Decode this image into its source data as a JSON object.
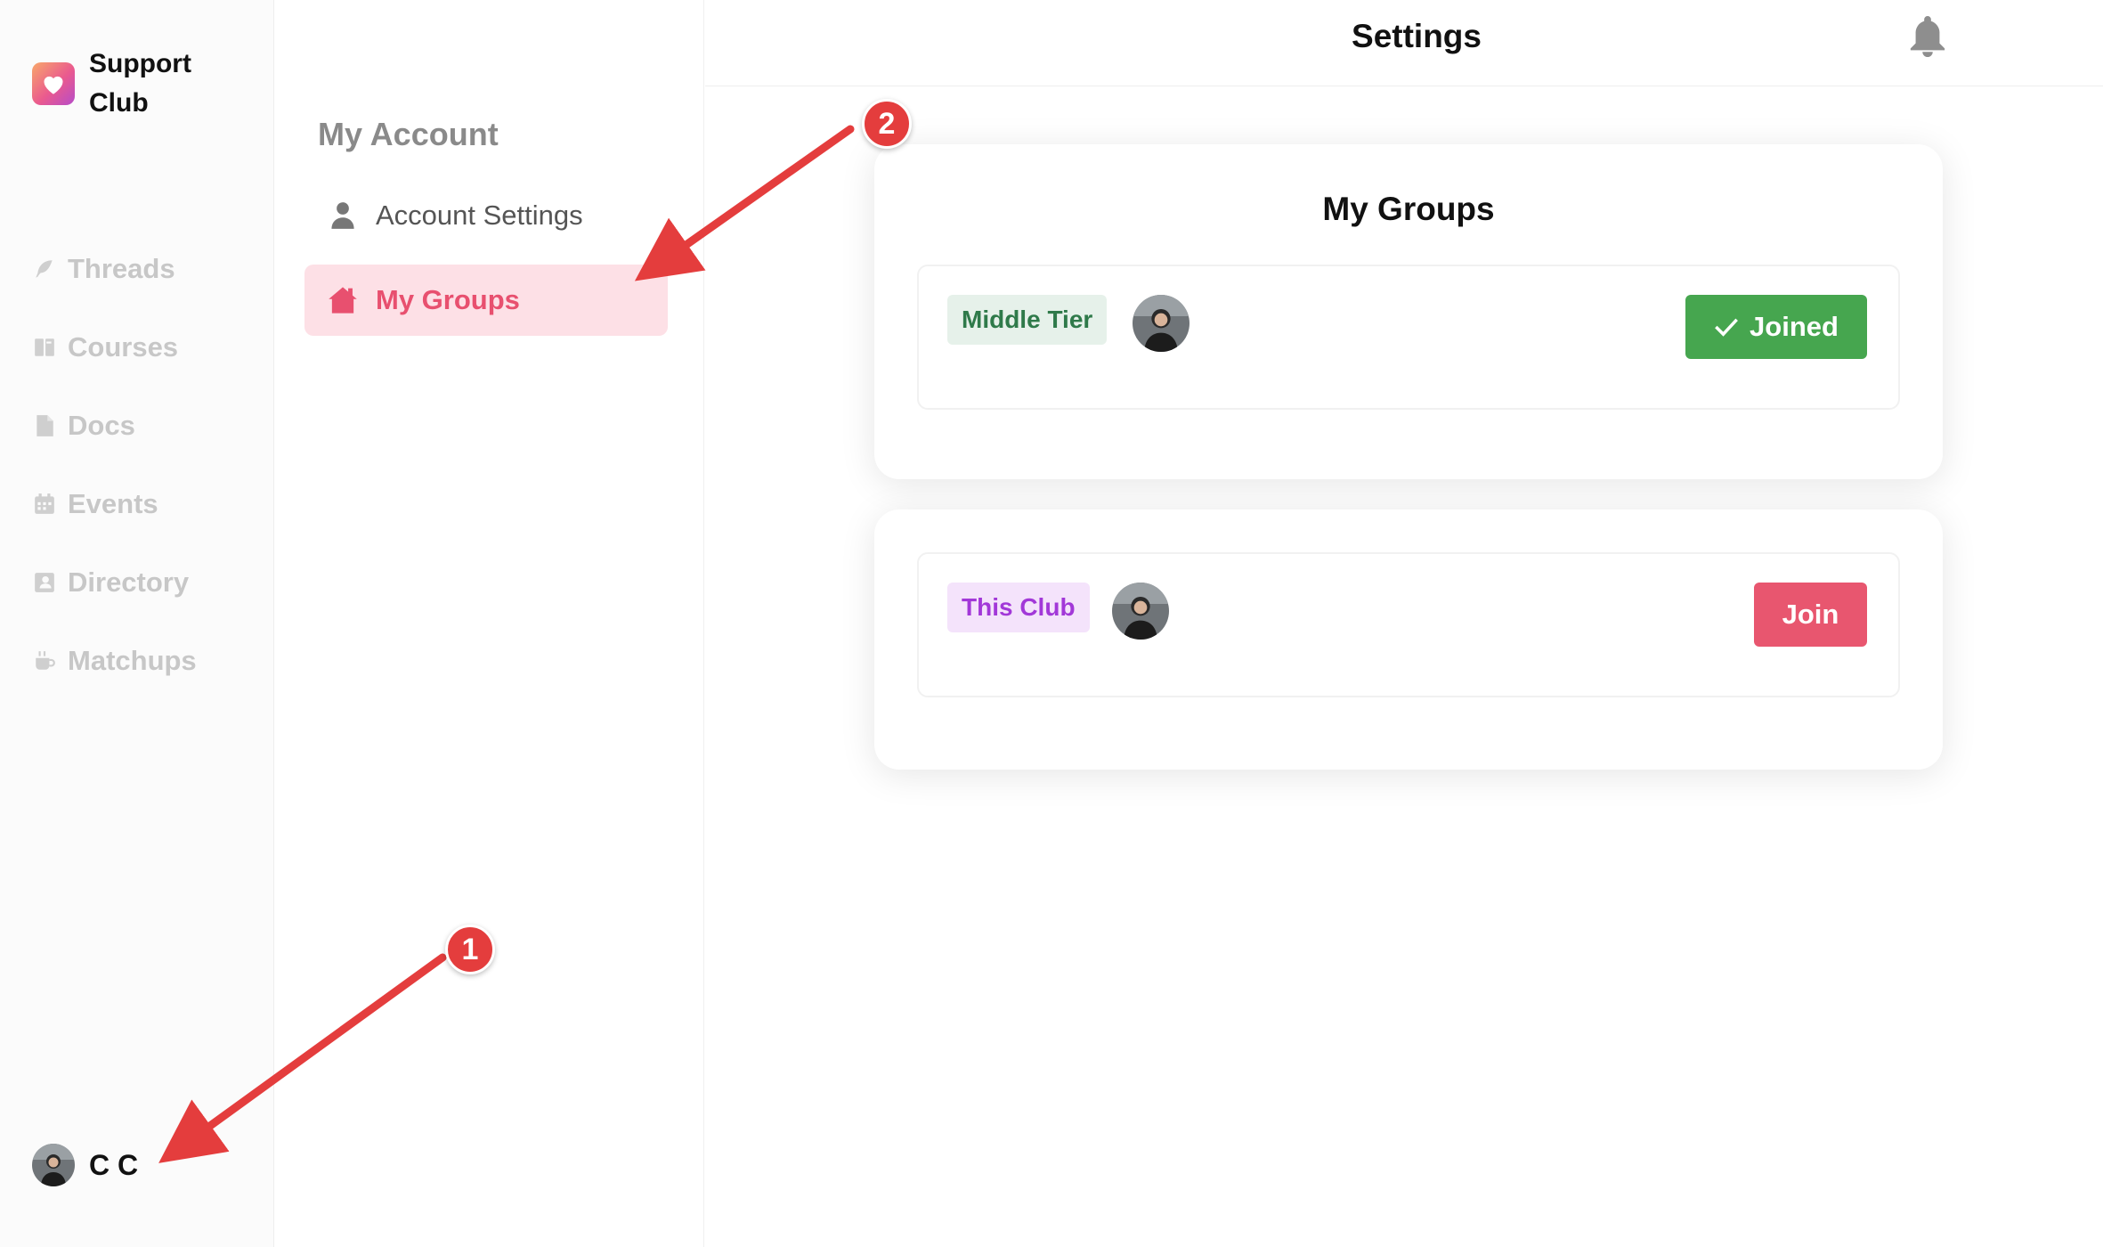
{
  "brand": {
    "name": "Support Club"
  },
  "nav": {
    "items": [
      {
        "label": "Threads",
        "icon": "feather-icon"
      },
      {
        "label": "Courses",
        "icon": "book-icon"
      },
      {
        "label": "Docs",
        "icon": "document-icon"
      },
      {
        "label": "Events",
        "icon": "calendar-icon"
      },
      {
        "label": "Directory",
        "icon": "contact-card-icon"
      },
      {
        "label": "Matchups",
        "icon": "coffee-cup-icon"
      }
    ]
  },
  "user": {
    "name": "C C"
  },
  "settings_nav": {
    "heading": "My Account",
    "items": [
      {
        "label": "Account Settings",
        "icon": "person-icon",
        "active": false
      },
      {
        "label": "My Groups",
        "icon": "house-icon",
        "active": true
      }
    ]
  },
  "header": {
    "title": "Settings",
    "notification_icon": "bell-icon"
  },
  "groups_card": {
    "title": "My Groups",
    "groups": [
      {
        "tag": "Middle Tier",
        "button": "Joined",
        "joined": true
      },
      {
        "tag": "This Club",
        "button": "Join",
        "joined": false
      }
    ]
  },
  "annotations": [
    {
      "number": "1"
    },
    {
      "number": "2"
    }
  ],
  "colors": {
    "accent_pink": "#e8506f",
    "active_bg": "#fde0e6",
    "joined_green": "#46a64f",
    "annotation_red": "#e43d3d"
  }
}
